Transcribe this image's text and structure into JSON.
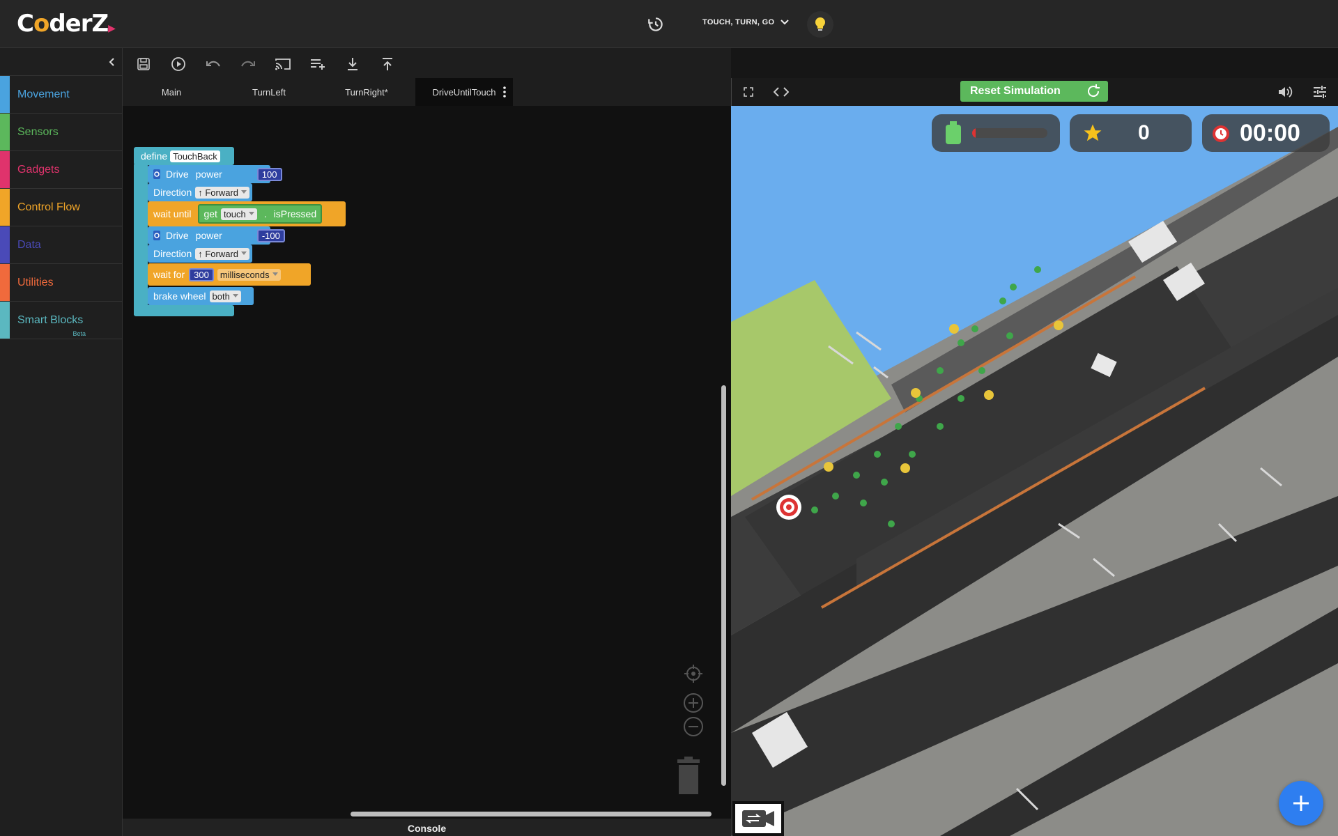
{
  "app": {
    "logo_text": "CoderZ"
  },
  "header": {
    "mission_title": "TOUCH, TURN, GO"
  },
  "sidebar": {
    "categories": [
      {
        "label": "Movement",
        "color": "#4aa3df"
      },
      {
        "label": "Sensors",
        "color": "#5cb85c"
      },
      {
        "label": "Gadgets",
        "color": "#e0336c"
      },
      {
        "label": "Control Flow",
        "color": "#f0a528"
      },
      {
        "label": "Data",
        "color": "#4a4ab8"
      },
      {
        "label": "Utilities",
        "color": "#f06a3c"
      },
      {
        "label": "Smart Blocks",
        "color": "#5bb8c0",
        "badge": "Beta"
      }
    ]
  },
  "toolbar": {
    "icons": [
      "save-icon",
      "play-icon",
      "undo-icon",
      "redo-icon",
      "cast-icon",
      "add-list-icon",
      "download-icon",
      "upload-icon"
    ]
  },
  "tabs": [
    {
      "label": "Main"
    },
    {
      "label": "TurnLeft"
    },
    {
      "label": "TurnRight*"
    },
    {
      "label": "DriveUntilTouch",
      "active": true
    }
  ],
  "blocks": {
    "define_label": "define",
    "define_name": "TouchBack",
    "drive1": {
      "label": "Drive",
      "power_label": "power",
      "power": "100",
      "direction_label": "Direction",
      "direction": "↑ Forward"
    },
    "wait_until": {
      "label": "wait until",
      "get": "get",
      "sensor": "touch",
      "dot": ".",
      "prop": "isPressed"
    },
    "drive2": {
      "label": "Drive",
      "power_label": "power",
      "power": "-100",
      "direction_label": "Direction",
      "direction": "↑ Forward"
    },
    "wait_for": {
      "label": "wait for",
      "value": "300",
      "unit": "milliseconds"
    },
    "brake": {
      "label": "brake wheel",
      "value": "both"
    }
  },
  "console": {
    "label": "Console"
  },
  "simulation": {
    "reset_label": "Reset Simulation",
    "score": "0",
    "timer": "00:00",
    "battery_fraction": 0.05
  },
  "colors": {
    "movement": "#4aa3df",
    "control": "#f0a528",
    "sensor": "#5cb85c",
    "reset": "#5cb85c",
    "fab": "#2e7ef0"
  }
}
